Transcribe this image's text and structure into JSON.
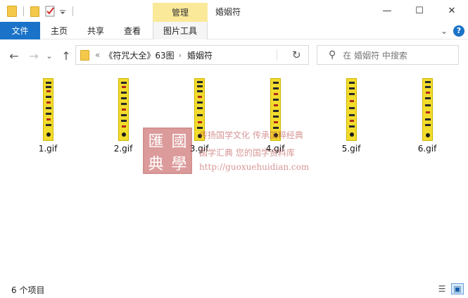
{
  "titlebar": {
    "manage_tab": "管理",
    "window_title": "婚姻符",
    "minimize_icon": "—",
    "maximize_icon": "☐",
    "close_icon": "✕"
  },
  "ribbon": {
    "tabs": [
      {
        "label": "文件"
      },
      {
        "label": "主页"
      },
      {
        "label": "共享"
      },
      {
        "label": "查看"
      },
      {
        "label": "图片工具"
      }
    ],
    "expand_icon": "⌄",
    "help_icon": "?"
  },
  "address": {
    "back_icon": "←",
    "forward_icon": "→",
    "recent_icon": "⌄",
    "up_icon": "↑",
    "overflow": "«",
    "segments": [
      "《符咒大全》63图",
      "婚姻符"
    ],
    "chevron": "›",
    "refresh_icon": "↻",
    "search_placeholder": "在 婚姻符 中搜索",
    "search_icon": "⚲"
  },
  "files": [
    {
      "name": "1.gif"
    },
    {
      "name": "2.gif"
    },
    {
      "name": "3.gif"
    },
    {
      "name": "4.gif"
    },
    {
      "name": "5.gif"
    },
    {
      "name": "6.gif"
    }
  ],
  "watermark": {
    "seal_chars": [
      "匯",
      "國",
      "典",
      "學"
    ],
    "line1": "传扬国学文化 传承国粹经典",
    "line2": "国学汇典 您的国学资料库",
    "url": "http://guoxuehuidian.com"
  },
  "status": {
    "count": "6 个项目",
    "details_view_icon": "☰",
    "large_icons_view_icon": "▣"
  },
  "colors": {
    "accent": "#1a73c8",
    "manage_tab_bg": "#fbe99a",
    "talisman_yellow": "#f2dc2c"
  }
}
